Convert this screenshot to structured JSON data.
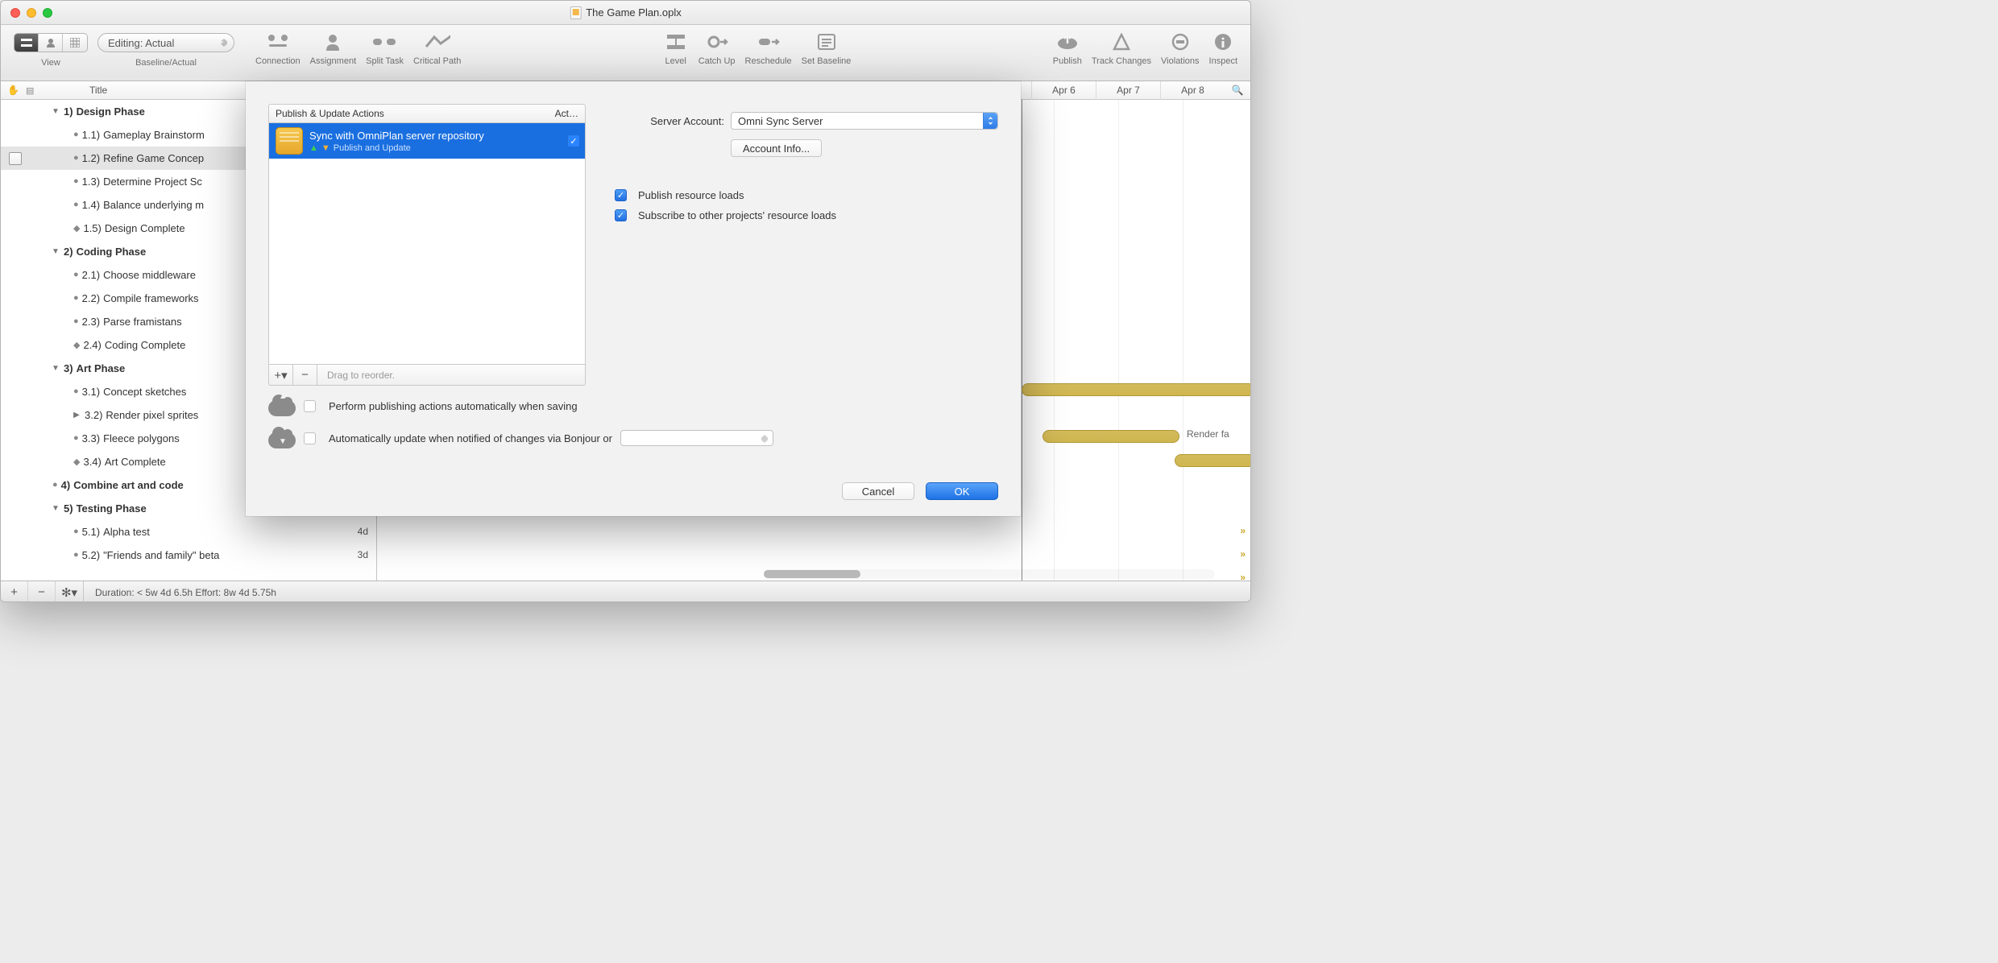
{
  "window": {
    "title": "The Game Plan.oplx"
  },
  "toolbar": {
    "view_label": "View",
    "baseline_pill": "Editing: Actual",
    "baseline_label": "Baseline/Actual",
    "connection": "Connection",
    "assignment": "Assignment",
    "split_task": "Split Task",
    "critical_path": "Critical Path",
    "level": "Level",
    "catch_up": "Catch Up",
    "reschedule": "Reschedule",
    "set_baseline": "Set Baseline",
    "publish": "Publish",
    "track_changes": "Track Changes",
    "violations": "Violations",
    "inspect": "Inspect"
  },
  "columns": {
    "title": "Title",
    "dates": [
      "Apr 6",
      "Apr 7",
      "Apr 8"
    ]
  },
  "outline": [
    {
      "kind": "phase",
      "disc": "▼",
      "num": "1)",
      "label": "Design Phase"
    },
    {
      "kind": "sub",
      "bullet": "●",
      "num": "1.1)",
      "label": "Gameplay Brainstorm"
    },
    {
      "kind": "sub",
      "bullet": "●",
      "num": "1.2)",
      "label": "Refine Game Concep",
      "selected": true
    },
    {
      "kind": "sub",
      "bullet": "●",
      "num": "1.3)",
      "label": "Determine Project Sc"
    },
    {
      "kind": "sub",
      "bullet": "●",
      "num": "1.4)",
      "label": "Balance underlying m"
    },
    {
      "kind": "sub",
      "bullet": "◆",
      "num": "1.5)",
      "label": "Design Complete"
    },
    {
      "kind": "phase",
      "disc": "▼",
      "num": "2)",
      "label": "Coding Phase"
    },
    {
      "kind": "sub",
      "bullet": "●",
      "num": "2.1)",
      "label": "Choose middleware"
    },
    {
      "kind": "sub",
      "bullet": "●",
      "num": "2.2)",
      "label": "Compile frameworks"
    },
    {
      "kind": "sub",
      "bullet": "●",
      "num": "2.3)",
      "label": "Parse framistans"
    },
    {
      "kind": "sub",
      "bullet": "◆",
      "num": "2.4)",
      "label": "Coding Complete"
    },
    {
      "kind": "phase",
      "disc": "▼",
      "num": "3)",
      "label": "Art Phase"
    },
    {
      "kind": "sub",
      "bullet": "●",
      "num": "3.1)",
      "label": "Concept sketches"
    },
    {
      "kind": "sub",
      "disc": "▶",
      "num": "3.2)",
      "label": "Render pixel sprites"
    },
    {
      "kind": "sub",
      "bullet": "●",
      "num": "3.3)",
      "label": "Fleece polygons"
    },
    {
      "kind": "sub",
      "bullet": "◆",
      "num": "3.4)",
      "label": "Art Complete"
    },
    {
      "kind": "phase",
      "bullet": "●",
      "num": "4)",
      "label": "Combine art and code"
    },
    {
      "kind": "phase",
      "disc": "▼",
      "num": "5)",
      "label": "Testing Phase",
      "dval": "..."
    },
    {
      "kind": "sub",
      "bullet": "●",
      "num": "5.1)",
      "label": "Alpha test",
      "dval": "4d"
    },
    {
      "kind": "sub",
      "bullet": "●",
      "num": "5.2)",
      "label": "\"Friends and family\" beta",
      "dval": "3d"
    }
  ],
  "gantt": {
    "barlabel": "Render fa"
  },
  "dialog": {
    "list_header": "Publish & Update Actions",
    "list_header2": "Act…",
    "item_title": "Sync with OmniPlan server repository",
    "item_sub": "Publish and Update",
    "reorder_hint": "Drag to reorder.",
    "server_account_label": "Server Account:",
    "server_account_value": "Omni Sync Server",
    "account_info": "Account Info...",
    "chk_publish": "Publish resource loads",
    "chk_subscribe": "Subscribe to other projects' resource loads",
    "auto_publish": "Perform publishing actions automatically when saving",
    "auto_update": "Automatically update when notified of changes via Bonjour or",
    "cancel": "Cancel",
    "ok": "OK"
  },
  "footer": {
    "text": "Duration: < 5w 4d 6.5h Effort: 8w 4d 5.75h"
  }
}
